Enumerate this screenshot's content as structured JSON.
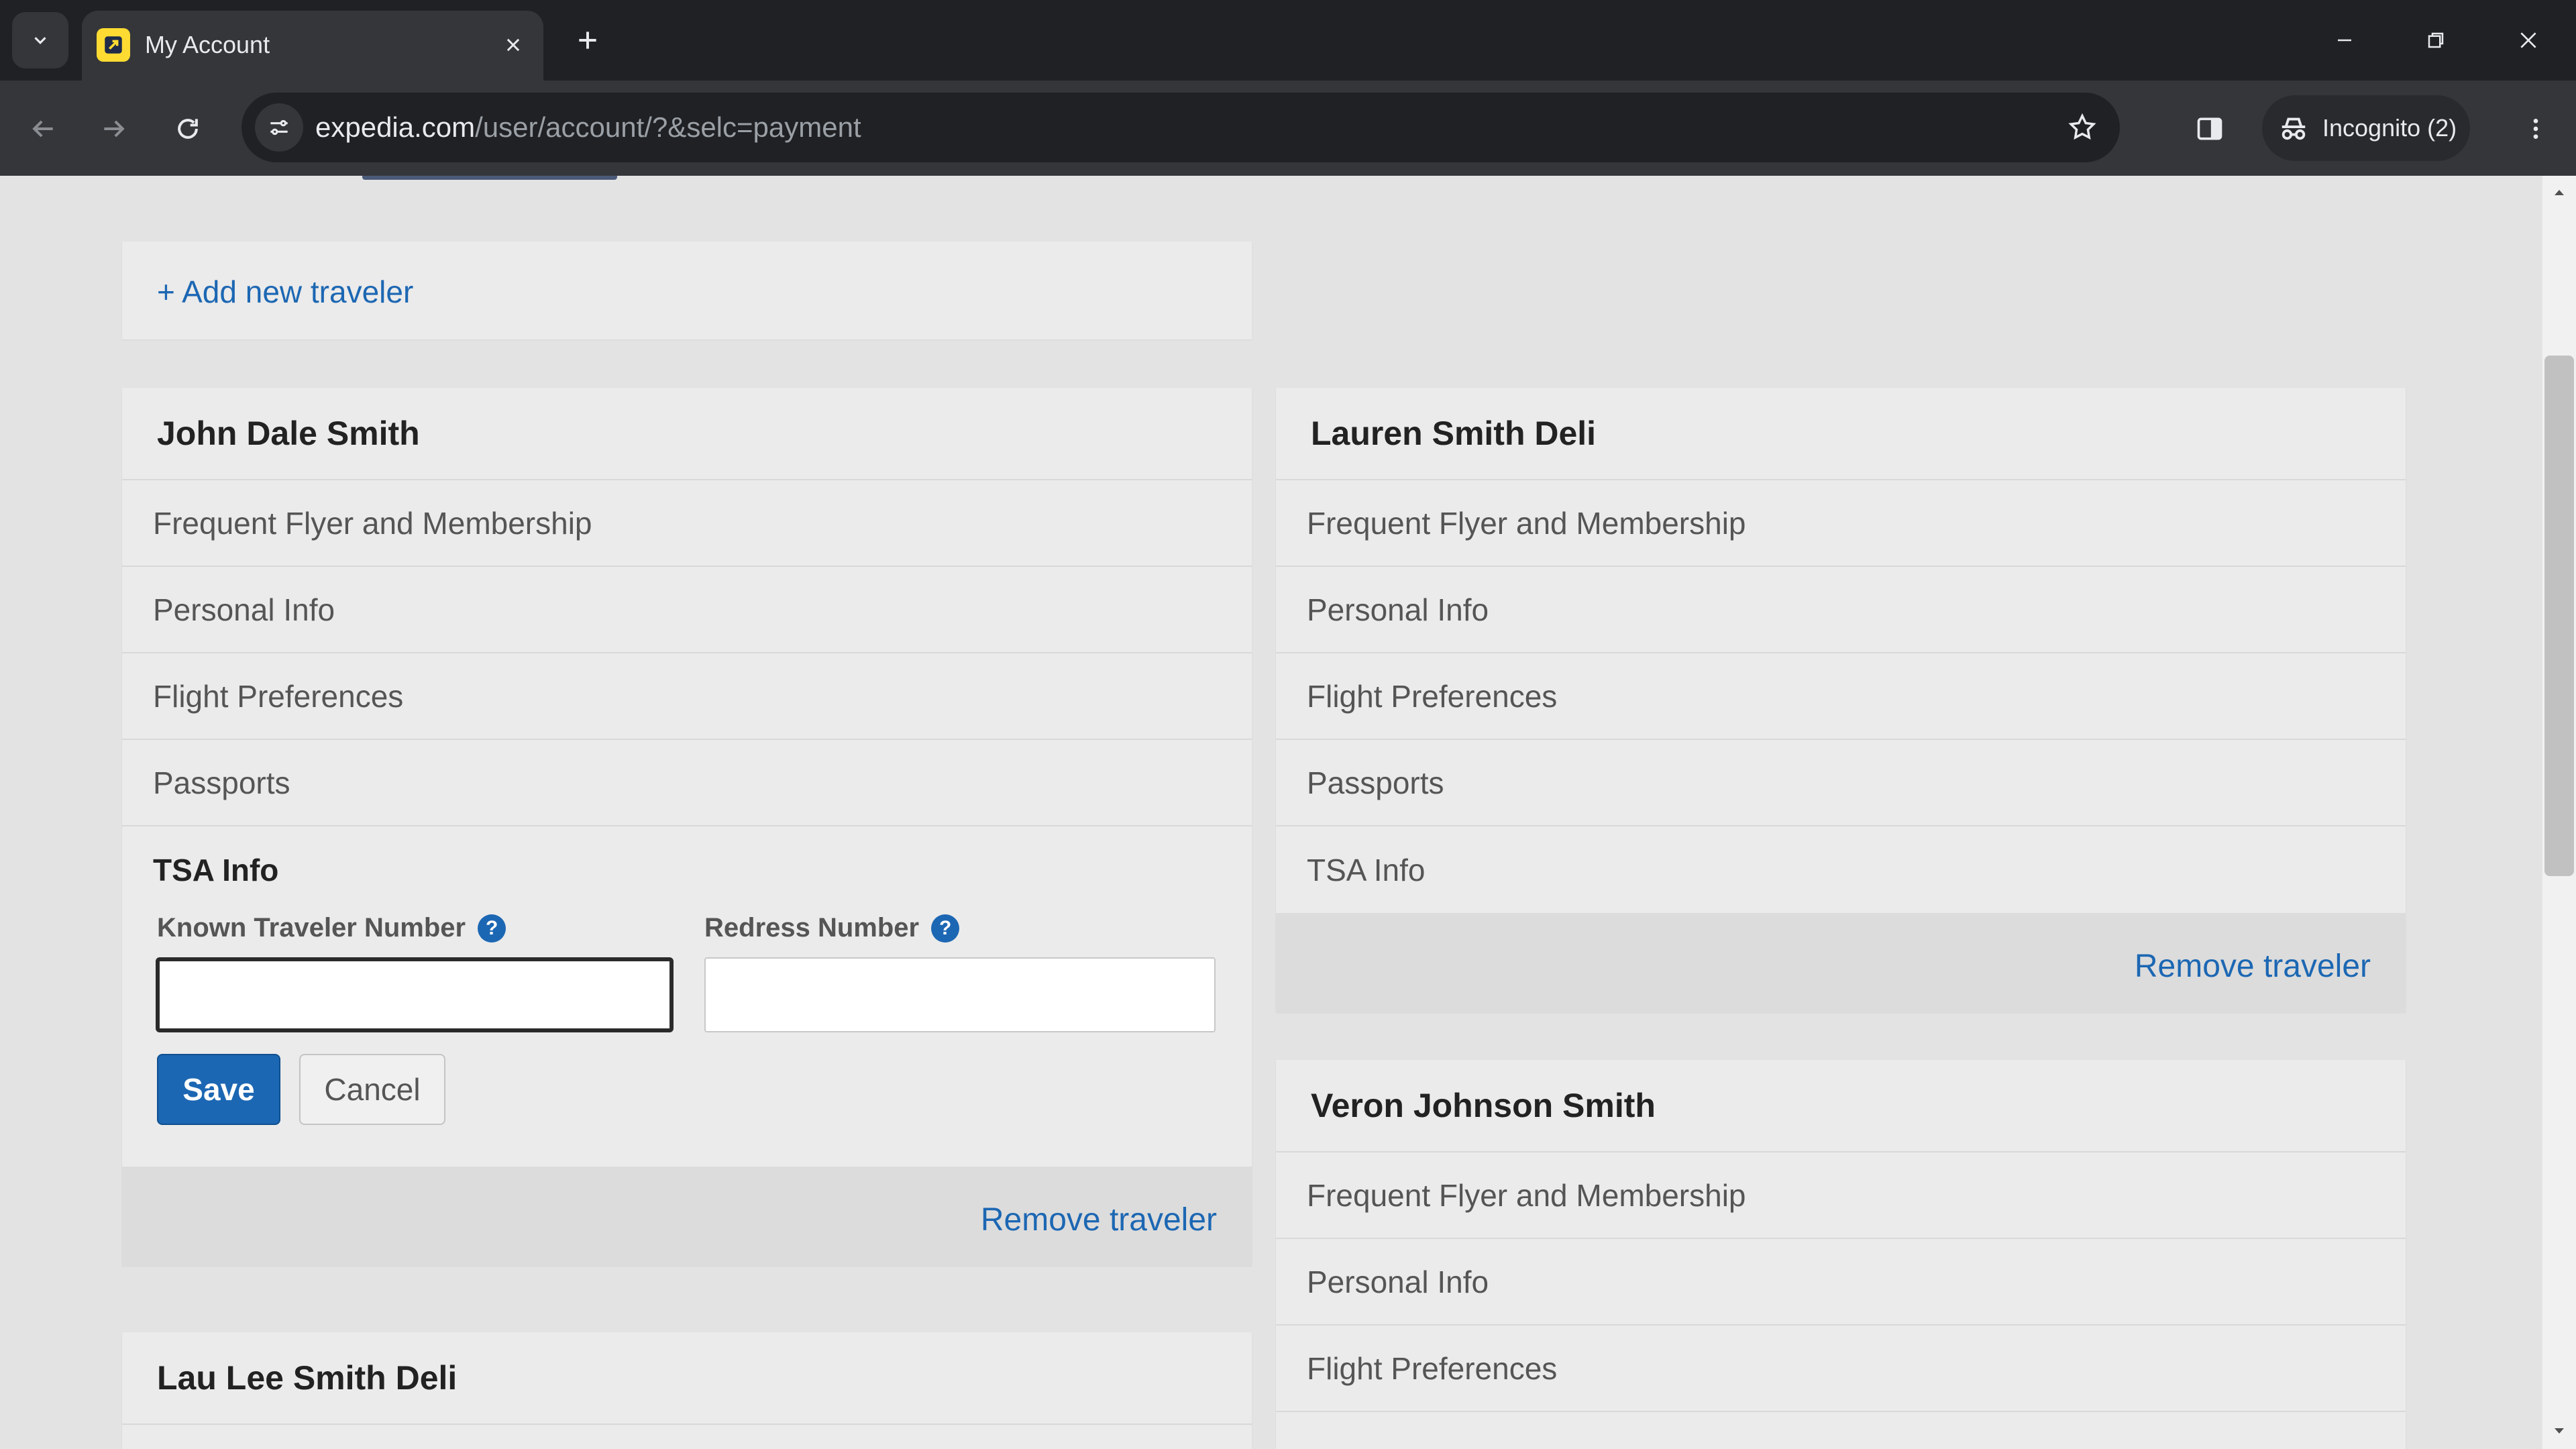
{
  "browser": {
    "tab_title": "My Account",
    "url_host": "expedia.com",
    "url_path": "/user/account/?&selc=payment",
    "incognito_label": "Incognito (2)",
    "icons": [
      "tab-search-icon",
      "favicon-icon",
      "close-icon",
      "plus-icon",
      "minimize-icon",
      "restore-icon",
      "close-window-icon",
      "back-arrow-icon",
      "forward-arrow-icon",
      "reload-icon",
      "site-settings-icon",
      "star-icon",
      "side-panel-icon",
      "incognito-icon",
      "more-vert-icon"
    ]
  },
  "page": {
    "add_traveler_label": "+ Add new traveler",
    "remove_label": "Remove traveler",
    "colors": {
      "link": "#1c67b3",
      "save_button": "#1c67b3",
      "card_bg": "#ebebeb",
      "page_bg": "#e3e3e3"
    },
    "travelers": [
      {
        "name": "John Dale Smith",
        "sections": [
          "Frequent Flyer and Membership",
          "Personal Info",
          "Flight Preferences",
          "Passports",
          "TSA Info"
        ],
        "tsa_form": {
          "known_traveler_label": "Known Traveler Number",
          "known_traveler_value": "",
          "redress_label": "Redress Number",
          "redress_value": "",
          "save_label": "Save",
          "cancel_label": "Cancel"
        }
      },
      {
        "name": "Lauren Smith Deli",
        "sections": [
          "Frequent Flyer and Membership",
          "Personal Info",
          "Flight Preferences",
          "Passports",
          "TSA Info"
        ]
      },
      {
        "name": "Veron Johnson Smith",
        "sections": [
          "Frequent Flyer and Membership",
          "Personal Info",
          "Flight Preferences"
        ]
      },
      {
        "name": "Lau Lee Smith Deli"
      }
    ]
  }
}
